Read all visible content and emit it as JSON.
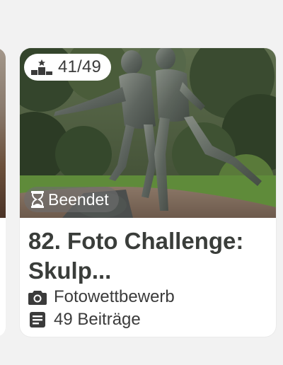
{
  "card": {
    "rank": "41/49",
    "status": "Beendet",
    "title": "82. Foto Challenge: Skulp...",
    "category": "Fotowettbewerb",
    "posts": "49 Beiträge"
  },
  "icons": {
    "rank": "podium-icon",
    "status": "hourglass-icon",
    "category": "camera-icon",
    "posts": "document-icon"
  },
  "colors": {
    "title_text": "#3a3d3a",
    "meta_text": "#3b3b3b",
    "card_background": "#ffffff",
    "page_background": "#f2f2f2",
    "status_badge_background": "#6e6e6e"
  }
}
